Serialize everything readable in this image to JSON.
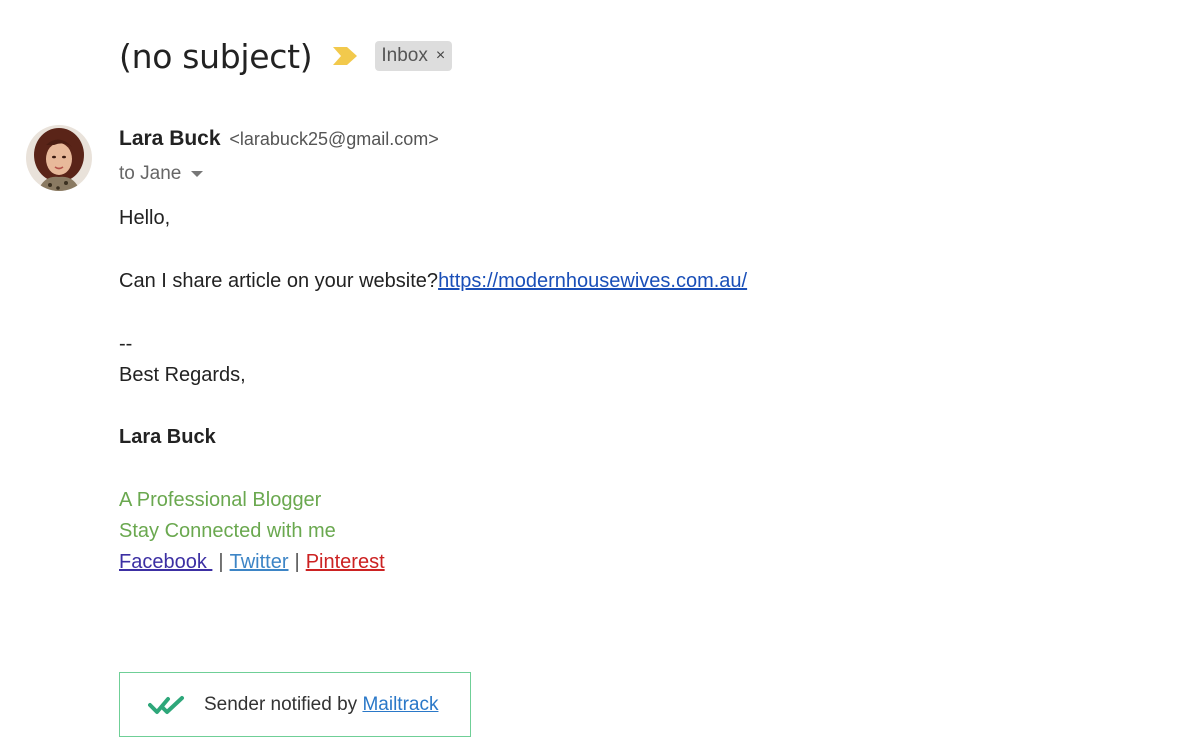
{
  "subject": "(no subject)",
  "label": {
    "name": "Inbox",
    "remove_glyph": "×"
  },
  "icons": {
    "importance": "importance-marker-icon",
    "caret": "chevron-down-icon",
    "mailtrack": "double-check-icon"
  },
  "colors": {
    "importance": "#f2c94c",
    "link": "#1a4fb8",
    "signature_green": "#6aa84f",
    "mailtrack_border": "#6fcf97"
  },
  "sender": {
    "name": "Lara Buck",
    "email": "<larabuck25@gmail.com>"
  },
  "recipient": {
    "text": "to Jane"
  },
  "body": {
    "greeting": "Hello,",
    "question": "Can I share article on your website?",
    "url": "https://modernhousewives.com.au/",
    "dashes": "--",
    "closing": "Best Regards,",
    "signature_name": "Lara Buck",
    "tagline": "A Professional Blogger",
    "connect": "Stay Connected with me",
    "social": {
      "facebook": "Facebook ",
      "twitter": "Twitter",
      "pinterest": "Pinterest",
      "separator": "|"
    }
  },
  "mailtrack": {
    "text": "Sender notified by ",
    "link": "Mailtrack"
  }
}
